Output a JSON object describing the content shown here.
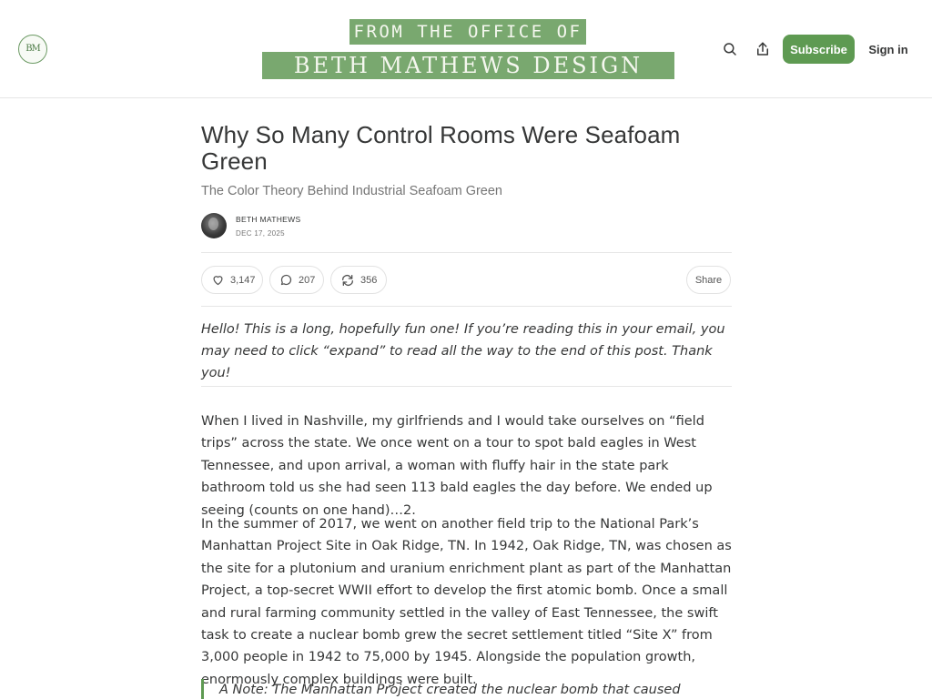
{
  "header": {
    "logo_text": "BM",
    "banner_top": "FROM THE OFFICE OF",
    "banner_bottom": "BETH MATHEWS DESIGN",
    "subscribe_label": "Subscribe",
    "signin_label": "Sign in",
    "icons": [
      "search-icon",
      "share-icon"
    ],
    "accent_color": "#5e9a52",
    "banner_color": "#79a86f"
  },
  "post": {
    "title": "Why So Many Control Rooms Were Seafoam Green",
    "subtitle": "The Color Theory Behind Industrial Seafoam Green",
    "author": "BETH MATHEWS",
    "date": "DEC 17, 2025",
    "likes": "3,147",
    "comments": "207",
    "restacks": "356",
    "share_label": "Share",
    "intro": "Hello! This is a long, hopefully fun one! If you’re reading this in your email, you may need to click “expand” to read all the way to the end of this post. Thank you!",
    "paragraphs": [
      "When I lived in Nashville, my girlfriends and I would take ourselves on “field trips” across the state. We once went on a tour to spot bald eagles in West Tennessee, and upon arrival, a woman with fluffy hair in the state park bathroom told us she had seen 113 bald eagles the day before. We ended up seeing (counts on one hand)…2.",
      "In the summer of 2017, we went on another field trip to the National Park’s Manhattan Project Site in Oak Ridge, TN. In 1942, Oak Ridge, TN, was chosen as the site for a plutonium and uranium enrichment plant as part of the Manhattan Project, a top-secret WWII effort to develop the first atomic bomb. Once a small and rural farming community settled in the valley of East Tennessee, the swift task to create a nuclear bomb grew the secret settlement titled “Site X” from 3,000 people in 1942 to 75,000 by 1945. Alongside the population growth, enormously complex buildings were built."
    ],
    "quote": "A Note: The Manhattan Project created the nuclear bomb that caused extreme"
  }
}
